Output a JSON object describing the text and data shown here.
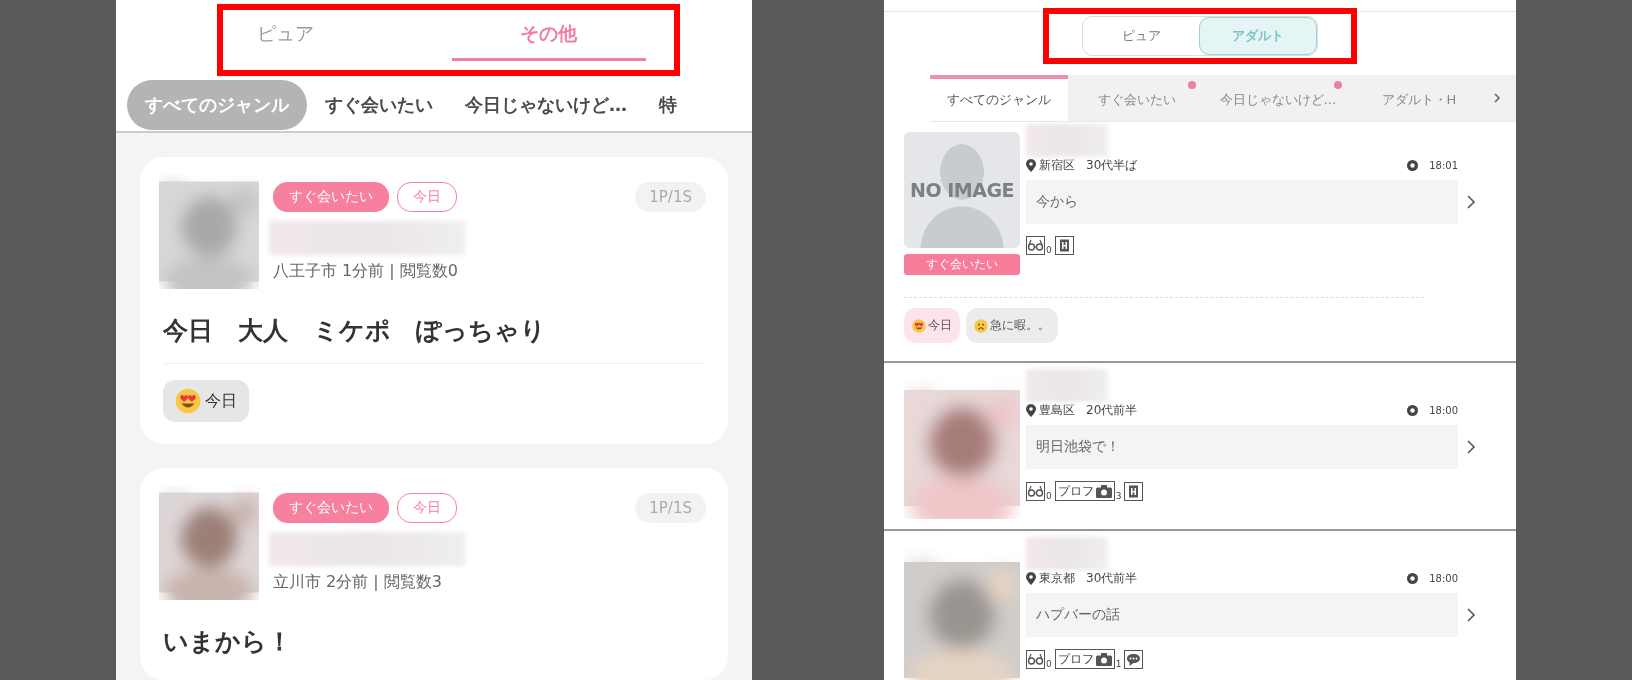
{
  "left_app": {
    "highlight": true,
    "mode_tabs": [
      {
        "label": "ピュア",
        "selected": false
      },
      {
        "label": "その他",
        "selected": true
      }
    ],
    "genres": [
      {
        "label": "すべてのジャンル",
        "selected": true
      },
      {
        "label": "すぐ会いたい",
        "selected": false
      },
      {
        "label": "今日じゃないけど…",
        "selected": false
      },
      {
        "label": "特",
        "selected": false
      }
    ],
    "posts": [
      {
        "tags": [
          {
            "label": "すぐ会いたい",
            "kind": "filled"
          },
          {
            "label": "今日",
            "kind": "outline"
          }
        ],
        "badge": "1P/1S",
        "meta": "八王子市 1分前 | 閲覧数0",
        "title": "今日　大人　ミケポ　ぽっちゃり",
        "reactions": [
          {
            "kind": "love",
            "label": "今日"
          }
        ]
      },
      {
        "tags": [
          {
            "label": "すぐ会いたい",
            "kind": "filled"
          },
          {
            "label": "今日",
            "kind": "outline"
          }
        ],
        "badge": "1P/1S",
        "meta": "立川市 2分前 | 閲覧数3",
        "title": "いまから！"
      }
    ]
  },
  "right_app": {
    "highlight": true,
    "mode_tabs": [
      {
        "label": "ピュア",
        "selected": false
      },
      {
        "label": "アダルト",
        "selected": true
      }
    ],
    "genres": [
      {
        "label": "すべてのジャンル",
        "selected": true,
        "new": false
      },
      {
        "label": "すぐ会いたい",
        "selected": false,
        "new": true
      },
      {
        "label": "今日じゃないけど…",
        "selected": false,
        "new": true
      },
      {
        "label": "アダルト・H",
        "selected": false,
        "new": false
      }
    ],
    "posts": [
      {
        "no_image": "NO IMAGE",
        "status": "すぐ会いたい",
        "area": "新宿区",
        "age": "30代半ば",
        "time": "18:01",
        "message": "今から",
        "stats": [
          {
            "kind": "views",
            "count": "0"
          },
          {
            "kind": "hotel"
          }
        ],
        "reactions": [
          {
            "kind": "love",
            "label": "今日"
          },
          {
            "kind": "sad",
            "label": "急に暇。。"
          }
        ]
      },
      {
        "area": "豊島区",
        "age": "20代前半",
        "time": "18:00",
        "message": "明日池袋で！",
        "stats": [
          {
            "kind": "views",
            "count": "0"
          },
          {
            "kind": "photos",
            "label": "プロフ",
            "count": "3"
          },
          {
            "kind": "hotel"
          }
        ]
      },
      {
        "area": "東京都",
        "age": "30代前半",
        "time": "18:00",
        "message": "ハプバーの話",
        "stats": [
          {
            "kind": "views",
            "count": "0"
          },
          {
            "kind": "photos",
            "label": "プロフ",
            "count": "1"
          },
          {
            "kind": "chat"
          }
        ]
      }
    ]
  }
}
